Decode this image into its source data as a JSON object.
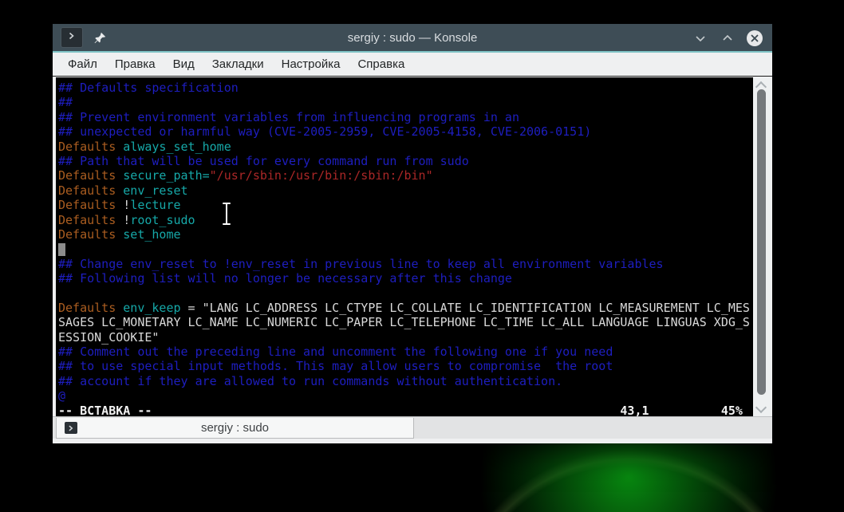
{
  "colors": {
    "titlebar_bg": "#3e4d56",
    "titlebar_accent": "#7fc4c6",
    "menubar_bg": "#eff0f1",
    "terminal_bg": "#000000",
    "syntax_comment_blue": "#1e1ec0",
    "syntax_keyword_orange": "#aa5d20",
    "syntax_ident_teal": "#16a8a8",
    "syntax_string_red": "#aa2727",
    "terminal_plain": "#d9d9d9",
    "status_white": "#f2f2f2"
  },
  "titlebar": {
    "title": "sergiy : sudo — Konsole",
    "app_icon": "konsole-prompt-icon",
    "pin_icon": "pin-icon",
    "minimize_icon": "chevron-down-icon",
    "maximize_icon": "chevron-up-icon",
    "close_icon": "close-circle-icon"
  },
  "menu": {
    "items": [
      {
        "label": "Файл"
      },
      {
        "label": "Правка"
      },
      {
        "label": "Вид"
      },
      {
        "label": "Закладки"
      },
      {
        "label": "Настройка"
      },
      {
        "label": "Справка"
      }
    ]
  },
  "terminal": {
    "lines": [
      [
        {
          "t": "## Defaults specification",
          "c": "comment"
        }
      ],
      [
        {
          "t": "##",
          "c": "comment"
        }
      ],
      [
        {
          "t": "## Prevent environment variables from influencing programs in an",
          "c": "comment"
        }
      ],
      [
        {
          "t": "## unexpected or harmful way (CVE-2005-2959, CVE-2005-4158, CVE-2006-0151)",
          "c": "comment"
        }
      ],
      [
        {
          "t": "Defaults",
          "c": "keyword"
        },
        {
          "t": " ",
          "c": "plain"
        },
        {
          "t": "always_set_home",
          "c": "ident"
        }
      ],
      [
        {
          "t": "## Path that will be used for every command run from sudo",
          "c": "comment"
        }
      ],
      [
        {
          "t": "Defaults",
          "c": "keyword"
        },
        {
          "t": " ",
          "c": "plain"
        },
        {
          "t": "secure_path=",
          "c": "ident"
        },
        {
          "t": "\"/usr/sbin:/usr/bin:/sbin:/bin\"",
          "c": "string"
        }
      ],
      [
        {
          "t": "Defaults",
          "c": "keyword"
        },
        {
          "t": " ",
          "c": "plain"
        },
        {
          "t": "env_reset",
          "c": "ident"
        }
      ],
      [
        {
          "t": "Defaults",
          "c": "keyword"
        },
        {
          "t": " !",
          "c": "plain"
        },
        {
          "t": "lecture",
          "c": "ident"
        }
      ],
      [
        {
          "t": "Defaults",
          "c": "keyword"
        },
        {
          "t": " !",
          "c": "plain"
        },
        {
          "t": "root_sudo",
          "c": "ident"
        }
      ],
      [
        {
          "t": "Defaults",
          "c": "keyword"
        },
        {
          "t": " ",
          "c": "plain"
        },
        {
          "t": "set_home",
          "c": "ident"
        }
      ],
      [
        {
          "cursor": true
        }
      ],
      [
        {
          "t": "## Change env_reset to !env_reset in previous line to keep all environment variables",
          "c": "comment"
        }
      ],
      [
        {
          "t": "## Following list will no longer be necessary after this change",
          "c": "comment"
        }
      ],
      [],
      [
        {
          "t": "Defaults",
          "c": "keyword"
        },
        {
          "t": " ",
          "c": "plain"
        },
        {
          "t": "env_keep",
          "c": "ident"
        },
        {
          "t": " = \"LANG LC_ADDRESS LC_CTYPE LC_COLLATE LC_IDENTIFICATION LC_MEASUREMENT LC_MES",
          "c": "plain"
        }
      ],
      [
        {
          "t": "SAGES LC_MONETARY LC_NAME LC_NUMERIC LC_PAPER LC_TELEPHONE LC_TIME LC_ALL LANGUAGE LINGUAS XDG_S",
          "c": "plain"
        }
      ],
      [
        {
          "t": "ESSION_COOKIE\"",
          "c": "plain"
        }
      ],
      [
        {
          "t": "## Comment out the preceding line and uncomment the following one if you need",
          "c": "comment"
        }
      ],
      [
        {
          "t": "## to use special input methods. This may allow users to compromise  the root",
          "c": "comment"
        }
      ],
      [
        {
          "t": "## account if they are allowed to run commands without authentication.",
          "c": "comment"
        }
      ],
      [
        {
          "t": "@",
          "c": "comment"
        }
      ],
      [
        {
          "t": "-- ВСТАВКА --",
          "c": "status"
        },
        {
          "t": "                                                                 ",
          "c": "plain"
        },
        {
          "t": "43,1",
          "c": "status"
        },
        {
          "t": "          ",
          "c": "plain"
        },
        {
          "t": "45%",
          "c": "status"
        }
      ]
    ],
    "status_mode": "-- ВСТАВКА --",
    "status_position": "43,1",
    "status_percent": "45%"
  },
  "tabbar": {
    "tabs": [
      {
        "label": "sergiy : sudo",
        "icon": "konsole-prompt-icon",
        "active": true
      }
    ]
  }
}
